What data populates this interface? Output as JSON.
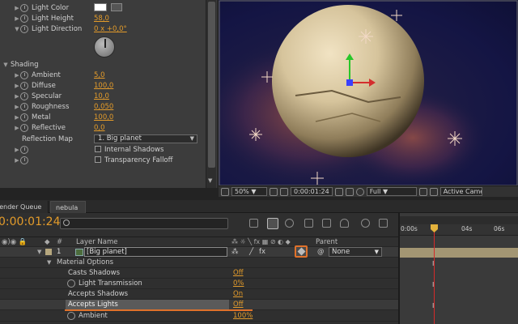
{
  "effects": {
    "light": [
      {
        "label": "Light Color",
        "value": ""
      },
      {
        "label": "Light Height",
        "value": "58,0"
      },
      {
        "label": "Light Direction",
        "value": "0 x +0,0°"
      }
    ],
    "shading_label": "Shading",
    "shading": [
      {
        "label": "Ambient",
        "value": "5,0"
      },
      {
        "label": "Diffuse",
        "value": "100,0"
      },
      {
        "label": "Specular",
        "value": "10,0"
      },
      {
        "label": "Roughness",
        "value": "0,050"
      },
      {
        "label": "Metal",
        "value": "100,0"
      },
      {
        "label": "Reflective",
        "value": "0,0"
      }
    ],
    "reflection_map_label": "Reflection Map",
    "reflection_map_value": "1. Big planet",
    "internal_shadows": "Internal Shadows",
    "transparency_falloff": "Transparency Falloff"
  },
  "viewer": {
    "zoom": "50%",
    "timecode": "0:00:01:24",
    "resolution": "Full",
    "view": "Active Camera"
  },
  "tabs": {
    "render_queue": "Render Queue",
    "comp": "nebula"
  },
  "timeline": {
    "current_time": "0:00:01:24",
    "search_placeholder": "",
    "col_hash": "#",
    "col_layer_name": "Layer Name",
    "col_parent": "Parent",
    "layer_number": "1",
    "layer_name": "[Big planet]",
    "parent_value": "None",
    "material_options": "Material Options",
    "options": [
      {
        "label": "Casts Shadows",
        "value": "Off"
      },
      {
        "label": "Light Transmission",
        "value": "0%"
      },
      {
        "label": "Accepts Shadows",
        "value": "On"
      },
      {
        "label": "Accepts Lights",
        "value": "Off"
      },
      {
        "label": "Ambient",
        "value": "100%"
      }
    ],
    "ruler": [
      "0:00s",
      "04s",
      "06s"
    ]
  },
  "colors": {
    "accent": "#e39b2a",
    "highlight": "#e0712a",
    "playhead": "#d62a2a"
  }
}
